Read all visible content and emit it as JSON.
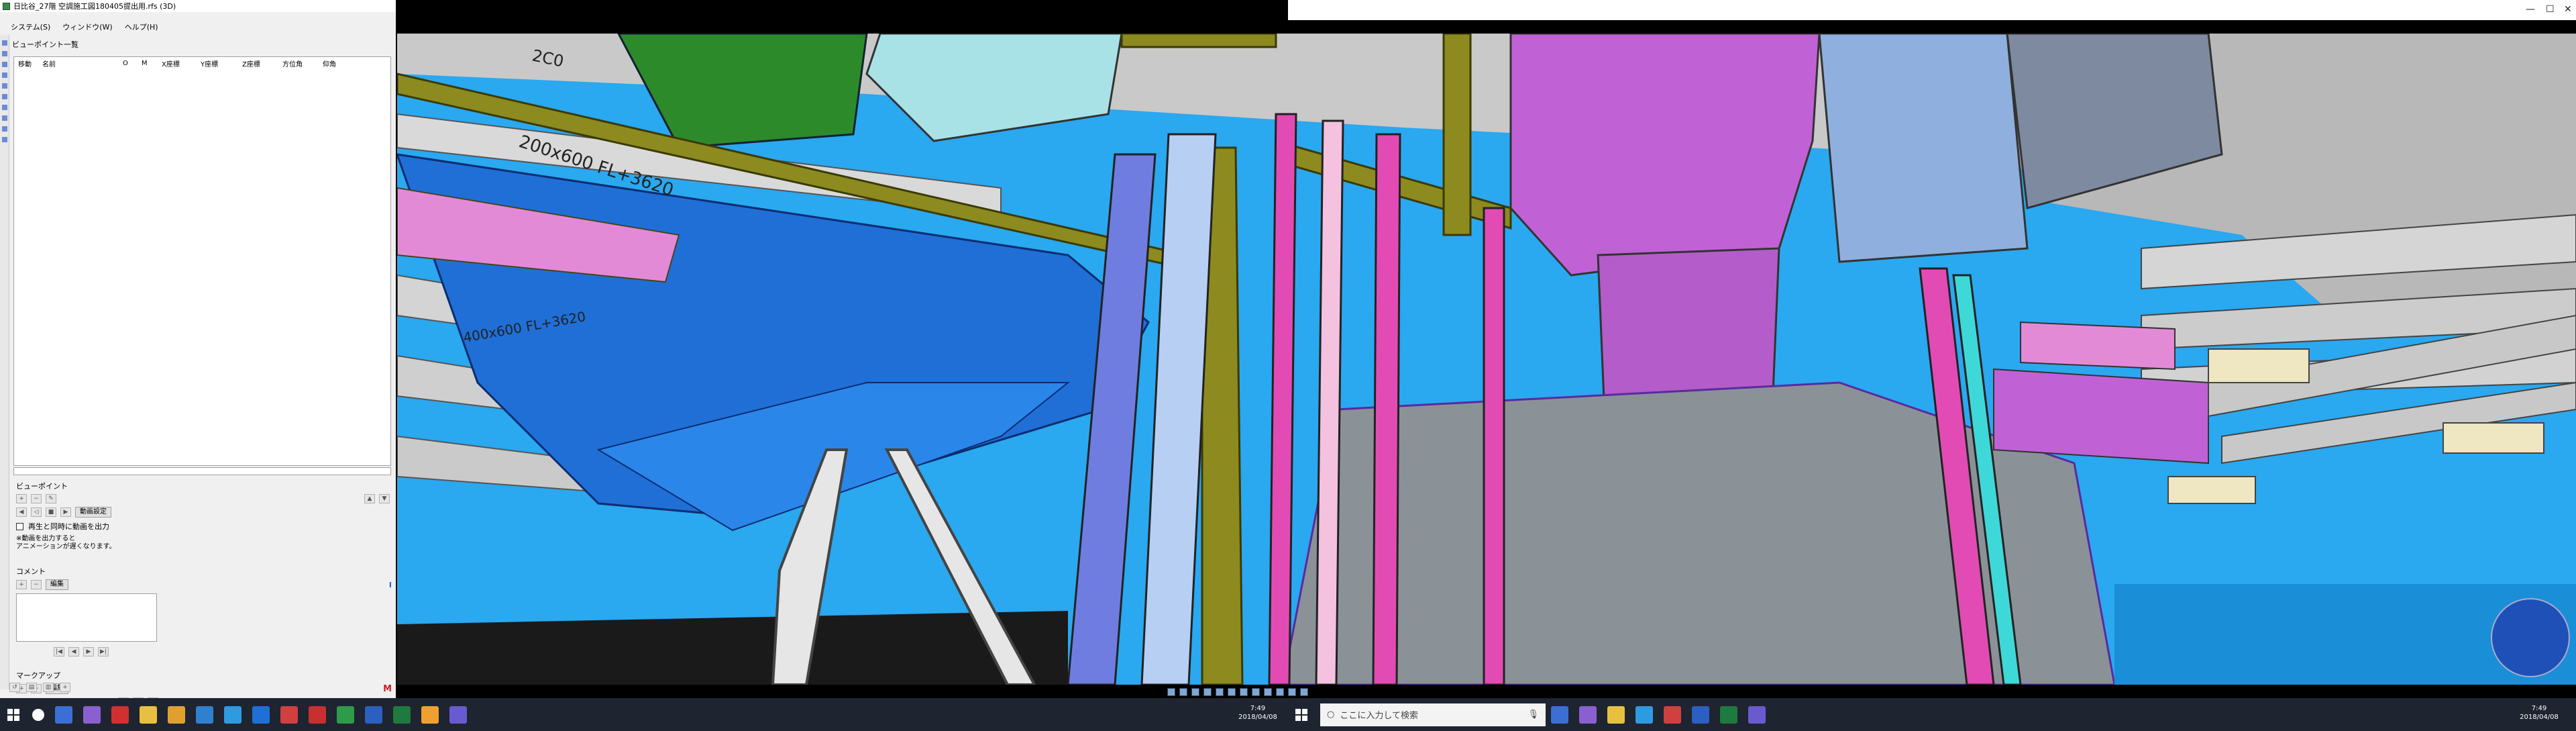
{
  "left_window": {
    "title": "日比谷_27階 空調施工図180405提出用.rfs (3D)",
    "menu": [
      "システム(S)",
      "ウィンドウ(W)",
      "ヘルプ(H)"
    ]
  },
  "viewpoint_panel": {
    "heading": "ビューポイント一覧",
    "columns": [
      "移動",
      "名前",
      "O",
      "M",
      "X座標",
      "Y座標",
      "Z座標",
      "方位角",
      "仰角"
    ],
    "section_viewpoint": "ビューポイント",
    "animation_settings_button": "動画設定",
    "output_checkbox_label": "再生と同時に動画を出力",
    "note": "※動画を出力すると\nアニメーションが遅くなります。",
    "section_comment": "コメント",
    "edit_label": "編集",
    "section_markup": "マークアップ",
    "markup_edit_label": "編集"
  },
  "viewport": {
    "labels": [
      "200x600 FL+3620",
      "400x600 FL+3620",
      "2C0"
    ]
  },
  "taskbar_left": {
    "time": "7:49",
    "date": "2018/04/08"
  },
  "taskbar_right": {
    "search_placeholder": "ここに入力して検索",
    "time": "7:49",
    "date": "2018/04/08"
  },
  "colors": {
    "sky": "#2aa8f0",
    "duct_blue": "#1f6fd6",
    "pipe_olive": "#8d8a1f",
    "pipe_pink": "#e24bb4",
    "duct_magenta": "#c062d6",
    "grey_box": "#8a9298"
  }
}
